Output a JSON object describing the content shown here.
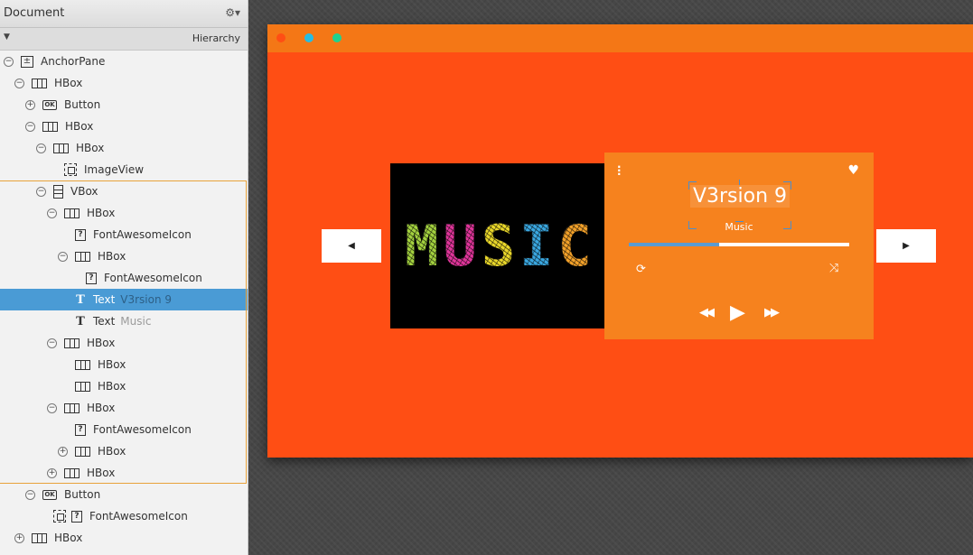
{
  "document_panel": {
    "title": "Document",
    "settings_icon": "gear-icon",
    "hierarchy_title": "Hierarchy",
    "tree": [
      {
        "toggle": "−",
        "icon": "anchorpane-icon",
        "type": "AnchorPane",
        "detail": ""
      },
      {
        "toggle": "−",
        "icon": "hbox-icon",
        "type": "HBox",
        "detail": ""
      },
      {
        "toggle": "+",
        "icon": "button-icon",
        "type": "Button",
        "detail": ""
      },
      {
        "toggle": "−",
        "icon": "hbox-icon",
        "type": "HBox",
        "detail": ""
      },
      {
        "toggle": "−",
        "icon": "hbox-icon",
        "type": "HBox",
        "detail": ""
      },
      {
        "toggle": "",
        "icon": "imageview-icon",
        "type": "ImageView",
        "detail": ""
      },
      {
        "toggle": "−",
        "icon": "vbox-icon",
        "type": "VBox",
        "detail": ""
      },
      {
        "toggle": "−",
        "icon": "hbox-icon",
        "type": "HBox",
        "detail": ""
      },
      {
        "toggle": "",
        "icon": "unknown-node-icon",
        "type": "FontAwesomeIcon",
        "detail": ""
      },
      {
        "toggle": "−",
        "icon": "hbox-icon",
        "type": "HBox",
        "detail": ""
      },
      {
        "toggle": "",
        "icon": "unknown-node-icon",
        "type": "FontAwesomeIcon",
        "detail": ""
      },
      {
        "toggle": "",
        "icon": "text-icon",
        "type": "Text",
        "detail": "V3rsion 9",
        "selected": true
      },
      {
        "toggle": "",
        "icon": "text-icon",
        "type": "Text",
        "detail": "Music"
      },
      {
        "toggle": "−",
        "icon": "hbox-icon",
        "type": "HBox",
        "detail": ""
      },
      {
        "toggle": "",
        "icon": "hbox-icon",
        "type": "HBox",
        "detail": ""
      },
      {
        "toggle": "",
        "icon": "hbox-icon",
        "type": "HBox",
        "detail": ""
      },
      {
        "toggle": "−",
        "icon": "hbox-icon",
        "type": "HBox",
        "detail": ""
      },
      {
        "toggle": "",
        "icon": "unknown-node-icon",
        "type": "FontAwesomeIcon",
        "detail": ""
      },
      {
        "toggle": "+",
        "icon": "hbox-icon",
        "type": "HBox",
        "detail": ""
      },
      {
        "toggle": "+",
        "icon": "hbox-icon",
        "type": "HBox",
        "detail": ""
      },
      {
        "toggle": "−",
        "icon": "button-icon",
        "type": "Button",
        "detail": ""
      },
      {
        "toggle": "",
        "icon": "unknown-node-icon",
        "type": "FontAwesomeIcon",
        "detail": "",
        "graphic": true
      },
      {
        "toggle": "+",
        "icon": "hbox-icon",
        "type": "HBox",
        "detail": ""
      }
    ]
  },
  "preview": {
    "colors": {
      "background": "#ff4e14",
      "titlebar": "#f47716",
      "player_panel": "#f6821e",
      "progress": "#5a9bd2"
    },
    "window_controls": [
      "close-dot",
      "minimize-dot",
      "maximize-dot"
    ],
    "album_art": {
      "word": [
        "M",
        "U",
        "S",
        "I",
        "C"
      ],
      "letter_colors": [
        "#a3d13f",
        "#e0359a",
        "#e8d62a",
        "#3aa7e0",
        "#f2a12a"
      ]
    },
    "player": {
      "menu_icon": "ellipsis-vertical-icon",
      "like_icon": "heart-icon",
      "song_title": "V3rsion 9",
      "song_artist": "Music",
      "progress": 0.41,
      "repeat_icon": "repeat-icon",
      "shuffle_icon": "shuffle-icon",
      "rewind_icon": "backward-icon",
      "play_icon": "play-icon",
      "forward_icon": "forward-icon"
    },
    "prev_icon": "caret-left-icon",
    "next_icon": "caret-right-icon"
  }
}
